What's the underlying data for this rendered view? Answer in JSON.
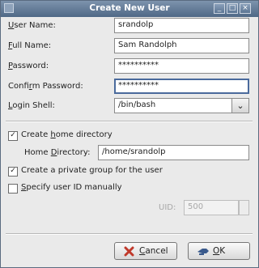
{
  "window": {
    "title": "Create New User",
    "min_glyph": "_",
    "max_glyph": "□",
    "close_glyph": "×"
  },
  "fields": {
    "username": {
      "label_key": "U",
      "label_rest": "ser Name:",
      "value": "srandolp"
    },
    "fullname": {
      "label_key": "F",
      "label_rest": "ull Name:",
      "value": "Sam Randolph"
    },
    "password": {
      "label_key": "P",
      "label_rest": "assword:",
      "value": "**********"
    },
    "confirm": {
      "label_pre": "Confi",
      "label_key": "r",
      "label_rest": "m Password:",
      "value": "**********"
    },
    "shell": {
      "label_key": "L",
      "label_rest": "ogin Shell:",
      "value": "/bin/bash",
      "arrow": "⌄"
    }
  },
  "home": {
    "create_label_pre": "Create ",
    "create_label_key": "h",
    "create_label_rest": "ome directory",
    "create_checked": true,
    "dir_label_pre": "Home ",
    "dir_label_key": "D",
    "dir_label_rest": "irectory:",
    "dir_value": "/home/srandolp"
  },
  "private_group": {
    "label": "Create a private group for the user",
    "checked": true
  },
  "manual_uid": {
    "label_key": "S",
    "label_rest": "pecify user ID manually",
    "checked": false,
    "uid_label": "UID:",
    "uid_value": "500"
  },
  "buttons": {
    "cancel_key": "C",
    "cancel_rest": "ancel",
    "ok_key": "O",
    "ok_rest": "K"
  },
  "check_glyph": "✓",
  "colors": {
    "titlebar": "#5c7593",
    "window_bg": "#eaeaea",
    "cancel_icon": "#c0392b",
    "ok_icon": "#3a5a8c"
  }
}
